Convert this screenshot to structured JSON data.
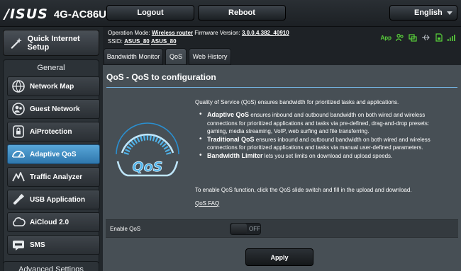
{
  "brand": {
    "logo": "/ISUS",
    "model": "4G-AC86U"
  },
  "topbar": {
    "logout": "Logout",
    "reboot": "Reboot",
    "language": "English"
  },
  "sidebar": {
    "quick_setup": "Quick Internet Setup",
    "section_general": "General",
    "items": [
      {
        "label": "Network Map",
        "icon": "network-map-icon"
      },
      {
        "label": "Guest Network",
        "icon": "guest-network-icon"
      },
      {
        "label": "AiProtection",
        "icon": "lock-icon"
      },
      {
        "label": "Adaptive QoS",
        "icon": "gauge-icon",
        "active": true
      },
      {
        "label": "Traffic Analyzer",
        "icon": "traffic-icon"
      },
      {
        "label": "USB Application",
        "icon": "usb-icon"
      },
      {
        "label": "AiCloud 2.0",
        "icon": "cloud-icon"
      },
      {
        "label": "SMS",
        "icon": "sms-icon"
      }
    ],
    "section_advanced": "Advanced Settings"
  },
  "info": {
    "operation_mode_label": "Operation Mode:",
    "operation_mode": "Wireless router",
    "firmware_label": "Firmware Version:",
    "firmware": "3.0.0.4.382_40910",
    "ssid_label": "SSID:",
    "ssid_1": "ASUS_80",
    "ssid_2": "ASUS_80",
    "app_label": "App"
  },
  "tabs": [
    {
      "label": "Bandwidth Monitor"
    },
    {
      "label": "QoS",
      "active": true
    },
    {
      "label": "Web History"
    }
  ],
  "page": {
    "title": "QoS - QoS to configuration",
    "intro": "Quality of Service (QoS) ensures bandwidth for prioritized tasks and applications.",
    "bullet1_bold": "Adaptive QoS",
    "bullet1_rest": " ensures inbound and outbound bandwidth on both wired and wireless connections for prioritized applications and tasks via pre-defined, drag-and-drop presets: gaming, media streaming, VoIP, web surfing and file transferring.",
    "bullet2_bold": "Traditional QoS",
    "bullet2_rest": " ensures inbound and outbound bandwidth on both wired and wireless connections for prioritized applications and tasks via manual user-defined parameters.",
    "bullet3_bold": "Bandwidth Limiter",
    "bullet3_rest": " lets you set limits on download and upload speeds.",
    "enable_text": "To enable QoS function, click the QoS slide switch and fill in the upload and download.",
    "faq": "QoS FAQ",
    "enable_label": "Enable QoS",
    "switch_state": "OFF",
    "apply": "Apply"
  },
  "colors": {
    "accent": "#2f77ad",
    "status_green": "#59d33b",
    "rule": "#75b5e3"
  }
}
